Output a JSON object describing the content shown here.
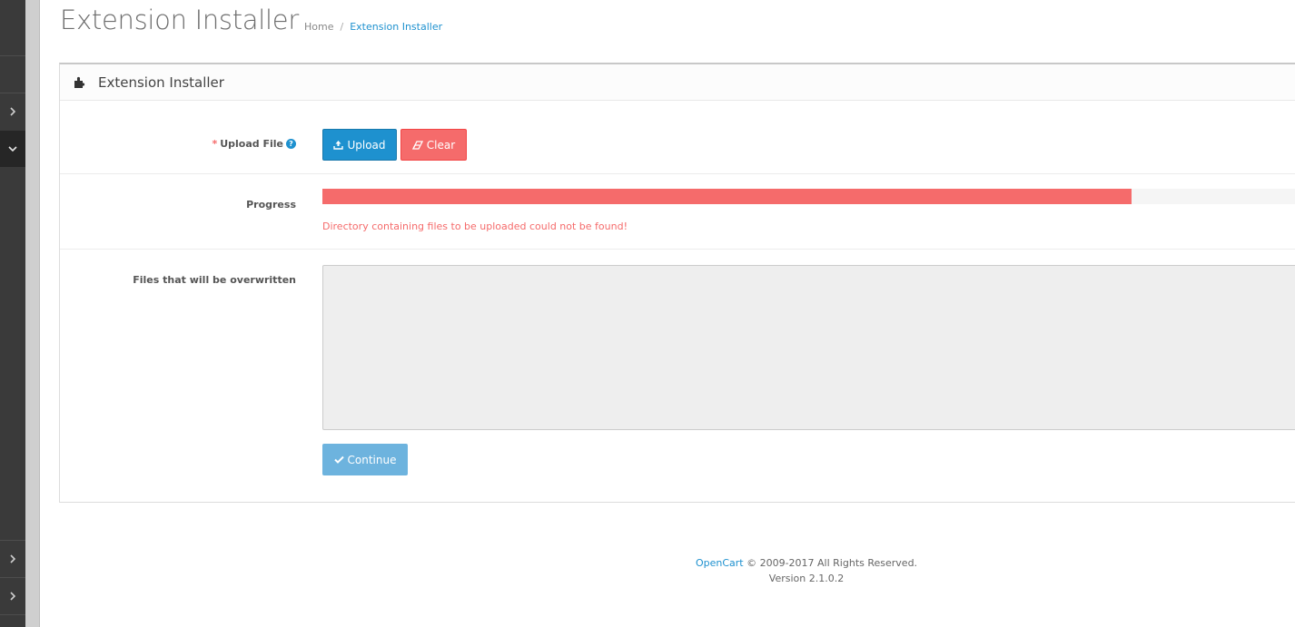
{
  "header": {
    "title": "Extension Installer",
    "breadcrumb": [
      {
        "label": "Home"
      },
      {
        "label": "Extension Installer"
      }
    ],
    "breadcrumb_divider": "/"
  },
  "panel": {
    "icon": "puzzle-icon",
    "title": "Extension Installer"
  },
  "upload": {
    "required_mark": "*",
    "label": "Upload File",
    "help_icon": "question-circle-icon",
    "upload_button": {
      "label": "Upload",
      "icon": "upload-icon"
    },
    "clear_button": {
      "label": "Clear",
      "icon": "eraser-icon"
    }
  },
  "progress": {
    "label": "Progress",
    "percent": 81,
    "error": "Directory containing files to be uploaded could not be found!"
  },
  "overwrite": {
    "label": "Files that will be overwritten",
    "value": "",
    "continue_button": {
      "label": "Continue",
      "icon": "check-icon"
    }
  },
  "footer": {
    "brand": "OpenCart",
    "copyright": "© 2009-2017 All Rights Reserved.",
    "version": "Version 2.1.0.2"
  },
  "colors": {
    "primary": "#1e91cf",
    "danger": "#f56b6b",
    "sidebar": "#3a3a3a"
  }
}
